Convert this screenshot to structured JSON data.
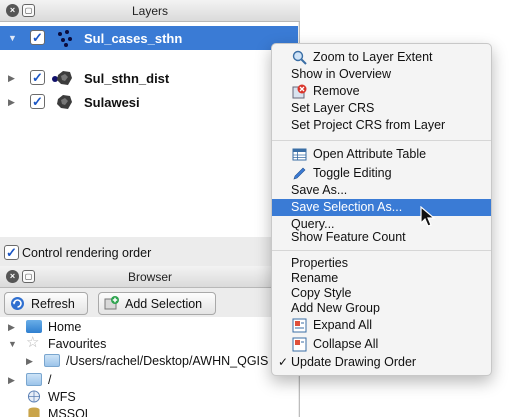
{
  "layers_panel": {
    "title": "Layers",
    "layers": [
      {
        "name": "Sul_cases_sthn",
        "checked": true,
        "selected": true,
        "expanded": true,
        "icon": "point-layer-icon"
      },
      {
        "name": "Sul_sthn_dist",
        "checked": true,
        "selected": false,
        "expanded": false,
        "icon": "polygon-layer-icon"
      },
      {
        "name": "Sulawesi",
        "checked": true,
        "selected": false,
        "expanded": false,
        "icon": "polygon-layer-icon"
      }
    ],
    "control_rendering_order": {
      "label": "Control rendering order",
      "checked": true
    }
  },
  "browser_panel": {
    "title": "Browser",
    "toolbar": {
      "refresh_label": "Refresh",
      "add_selection_label": "Add Selection"
    },
    "tree": [
      {
        "label": "Home",
        "icon": "folder-icon"
      },
      {
        "label": "Favourites",
        "icon": "star-icon"
      },
      {
        "label": "/Users/rachel/Desktop/AWHN_QGIS",
        "icon": "folder-icon"
      },
      {
        "label": "/",
        "icon": "folder-icon"
      },
      {
        "label": "WFS",
        "icon": "wfs-icon"
      },
      {
        "label": "MSSQL",
        "icon": "database-icon"
      }
    ]
  },
  "context_menu": {
    "items": [
      {
        "label": "Zoom to Layer Extent",
        "icon": "zoom-icon"
      },
      {
        "label": "Show in Overview"
      },
      {
        "label": "Remove",
        "icon": "remove-icon"
      },
      {
        "label": "Set Layer CRS"
      },
      {
        "label": "Set Project CRS from Layer"
      },
      {
        "label": "Open Attribute Table",
        "icon": "table-icon"
      },
      {
        "label": "Toggle Editing",
        "icon": "pencil-icon"
      },
      {
        "label": "Save As..."
      },
      {
        "label": "Save Selection As...",
        "active": true
      },
      {
        "label": "Query..."
      },
      {
        "label": "Show Feature Count"
      },
      {
        "label": "Properties"
      },
      {
        "label": "Rename"
      },
      {
        "label": "Copy Style"
      },
      {
        "label": "Add New Group"
      },
      {
        "label": "Expand All",
        "icon": "expand-icon"
      },
      {
        "label": "Collapse All",
        "icon": "collapse-icon"
      },
      {
        "label": "Update Drawing Order",
        "checked": true
      }
    ]
  },
  "colors": {
    "selection": "#3a7bd5",
    "panel_bg": "#ececec",
    "menu_bg": "#f4f4f4"
  }
}
